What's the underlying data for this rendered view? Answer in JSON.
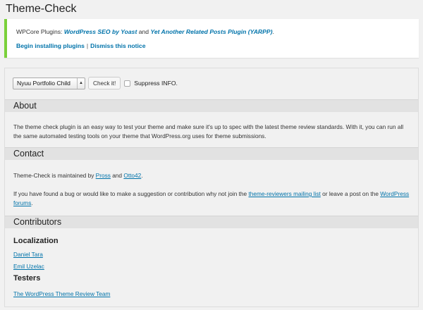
{
  "page": {
    "title": "Theme-Check"
  },
  "notice": {
    "prefix": "WPCore Plugins: ",
    "plugin1": "WordPress SEO by Yoast",
    "and": " and ",
    "plugin2": "Yet Another Related Posts Plugin (YARPP)",
    "suffix": ".",
    "begin_link": "Begin installing plugins",
    "separator": "|",
    "dismiss_link": "Dismiss this notice",
    "accent_color": "#7ad03a"
  },
  "toolbar": {
    "theme_selected": "Nyuu Portfolio Child",
    "check_button": "Check it!",
    "suppress_label": "Suppress INFO.",
    "suppress_checked": false
  },
  "about": {
    "heading": "About",
    "body": "The theme check plugin is an easy way to test your theme and make sure it's up to spec with the latest theme review standards. With it, you can run all the same automated testing tools on your theme that WordPress.org uses for theme submissions."
  },
  "contact": {
    "heading": "Contact",
    "maintained_prefix": "Theme-Check is maintained by ",
    "maintainer1": "Pross",
    "maintained_and": " and ",
    "maintainer2": "Otto42",
    "maintained_suffix": ".",
    "bug_prefix": "If you have found a bug or would like to make a suggestion or contribution why not join the ",
    "mailing_list": "theme-reviewers mailing list",
    "bug_middle": " or leave a post on the ",
    "forums": "WordPress forums",
    "bug_suffix": "."
  },
  "contributors": {
    "heading": "Contributors",
    "localization_heading": "Localization",
    "localization": [
      "Daniel Tara",
      "Emil Uzelac"
    ],
    "testers_heading": "Testers",
    "testers": [
      "The WordPress Theme Review Team"
    ]
  }
}
